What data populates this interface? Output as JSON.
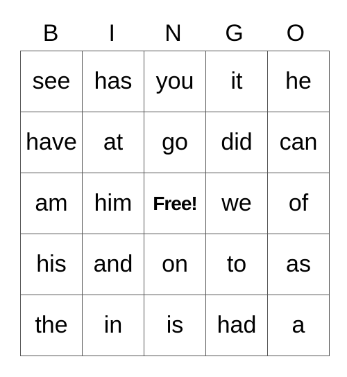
{
  "header": [
    "B",
    "I",
    "N",
    "G",
    "O"
  ],
  "rows": [
    [
      "see",
      "has",
      "you",
      "it",
      "he"
    ],
    [
      "have",
      "at",
      "go",
      "did",
      "can"
    ],
    [
      "am",
      "him",
      "Free!",
      "we",
      "of"
    ],
    [
      "his",
      "and",
      "on",
      "to",
      "as"
    ],
    [
      "the",
      "in",
      "is",
      "had",
      "a"
    ]
  ],
  "free_cell": {
    "row": 2,
    "col": 2
  }
}
